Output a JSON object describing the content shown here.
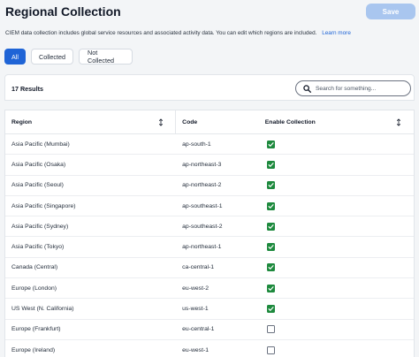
{
  "page": {
    "title": "Regional Collection",
    "save_label": "Save",
    "description": "CIEM data collection includes global service resources and associated activity data. You can edit which regions are included.",
    "learn_more": "Learn more"
  },
  "filters": {
    "tabs": [
      "All",
      "Collected",
      "Not Collected"
    ],
    "active": "All"
  },
  "results": {
    "count_label": "17 Results",
    "search_placeholder": "Search for something..."
  },
  "table": {
    "columns": [
      "Region",
      "Code",
      "Enable Collection"
    ],
    "rows": [
      {
        "region": "Asia Pacific (Mumbai)",
        "code": "ap-south-1",
        "enabled": true
      },
      {
        "region": "Asia Pacific (Osaka)",
        "code": "ap-northeast-3",
        "enabled": true
      },
      {
        "region": "Asia Pacific (Seoul)",
        "code": "ap-northeast-2",
        "enabled": true
      },
      {
        "region": "Asia Pacific (Singapore)",
        "code": "ap-southeast-1",
        "enabled": true
      },
      {
        "region": "Asia Pacific (Sydney)",
        "code": "ap-southeast-2",
        "enabled": true
      },
      {
        "region": "Asia Pacific (Tokyo)",
        "code": "ap-northeast-1",
        "enabled": true
      },
      {
        "region": "Canada (Central)",
        "code": "ca-central-1",
        "enabled": true
      },
      {
        "region": "Europe (London)",
        "code": "eu-west-2",
        "enabled": true
      },
      {
        "region": "US West (N. California)",
        "code": "us-west-1",
        "enabled": true
      },
      {
        "region": "Europe (Frankfurt)",
        "code": "eu-central-1",
        "enabled": false
      },
      {
        "region": "Europe (Ireland)",
        "code": "eu-west-1",
        "enabled": false
      }
    ]
  },
  "icons": {
    "search": "search-icon",
    "sort": "sort-icon",
    "check": "check-icon"
  },
  "colors": {
    "primary": "#1f64d6",
    "save_disabled": "#a9c6ef",
    "checkbox_checked": "#1e8a3e"
  }
}
